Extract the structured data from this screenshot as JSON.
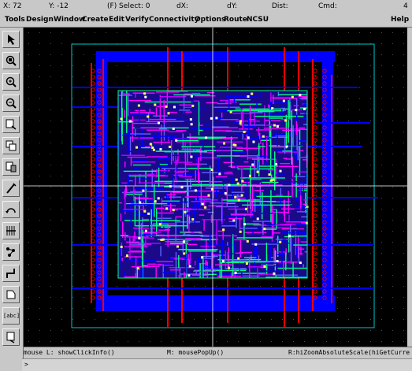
{
  "status": {
    "x": "X:  72",
    "y": "Y:  -12",
    "select": "(F) Select: 0",
    "dx": "dX:",
    "dy": "dY:",
    "dist": "Dist:",
    "cmd": "Cmd:",
    "count": "4"
  },
  "menu": {
    "items": [
      "Tools",
      "Design",
      "Window",
      "Create",
      "Edit",
      "Verify",
      "Connectivity",
      "Options",
      "Route",
      "NCSU"
    ],
    "help": "Help"
  },
  "toolbar": {
    "icons": [
      "pointer-icon",
      "zoom-fit-icon",
      "zoom-in-icon",
      "zoom-out-icon",
      "stretch-icon",
      "copy-icon",
      "move-icon",
      "delete-icon",
      "undo-icon",
      "property-icon",
      "hierarchy-icon",
      "path-icon",
      "instance-icon",
      "label-icon",
      "rectangle-icon"
    ],
    "label_tool": "[abc]"
  },
  "mouse": {
    "left": "mouse L: showClickInfo()",
    "middle": "M: mousePopUp()",
    "right": "R:hiZoomAbsoluteScale(hiGetCurre"
  },
  "cmdline": {
    "prompt": ">"
  },
  "colors": {
    "canvas_bg": "#000000",
    "boundary": "#00c8c8",
    "metal1": "#0000ff",
    "metal2": "#ff00ff",
    "poly": "#ff0000",
    "via": "#00ff80",
    "grid": "#4a4a4a",
    "crosshair": "#ffffff"
  }
}
